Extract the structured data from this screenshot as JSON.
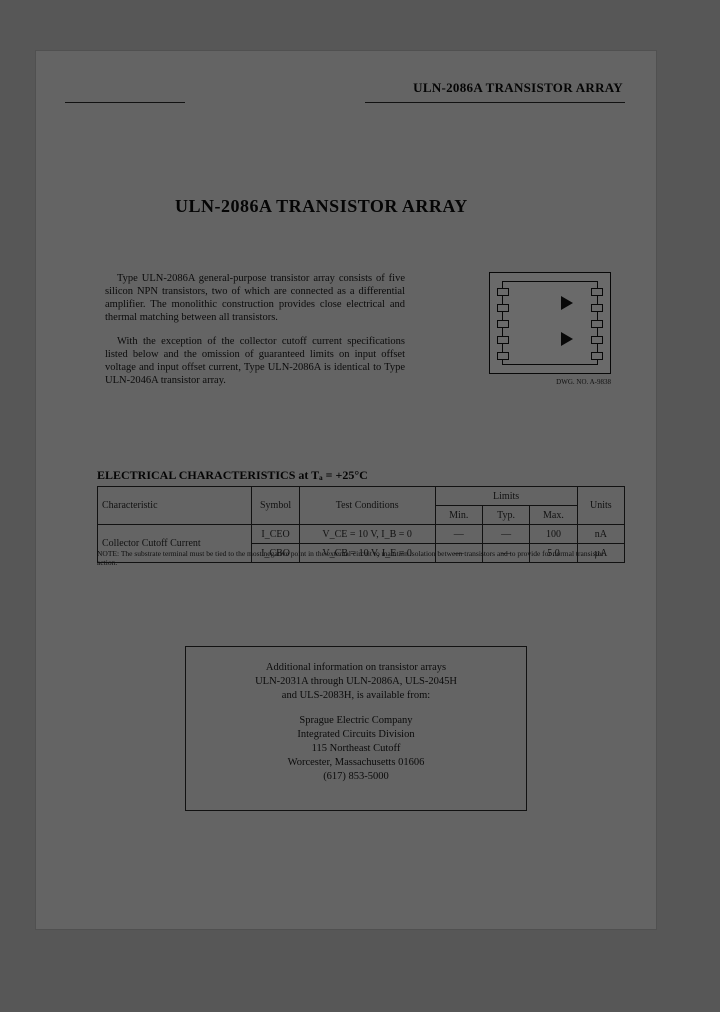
{
  "header": {
    "right_title": "ULN-2086A TRANSISTOR ARRAY"
  },
  "title": "ULN-2086A TRANSISTOR ARRAY",
  "intro": {
    "p1": "Type ULN-2086A general-purpose transistor array consists of five silicon NPN transistors, two of which are connected as a differential amplifier. The monolithic construction provides close electrical and thermal matching between all transistors.",
    "p2": "With the exception of the collector cutoff current specifications listed below and the omission of guaranteed limits on input offset voltage and input offset current, Type ULN-2086A is identical to Type ULN-2046A transistor array."
  },
  "diagram": {
    "caption": "DWG. NO. A-9838"
  },
  "ec_heading": "ELECTRICAL CHARACTERISTICS at Tₐ = +25°C",
  "table": {
    "headers": {
      "characteristic": "Characteristic",
      "symbol": "Symbol",
      "test_conditions": "Test Conditions",
      "limits": "Limits",
      "min": "Min.",
      "typ": "Typ.",
      "max": "Max.",
      "units": "Units"
    },
    "rows": [
      {
        "characteristic": "Collector Cutoff Current",
        "symbol": "I_CEO",
        "test_conditions": "V_CE = 10 V, I_B = 0",
        "min": "—",
        "typ": "—",
        "max": "100",
        "units": "nA"
      },
      {
        "characteristic": "",
        "symbol": "I_CBO",
        "test_conditions": "V_CB = 10 V, I_E = 0",
        "min": "—",
        "typ": "—",
        "max": "5.0",
        "units": "µA"
      }
    ]
  },
  "note": "NOTE: The substrate terminal must be tied to the most negative point in the external circuit to maintain isolation between transistors and to provide for normal transistor action.",
  "info_box": {
    "line1": "Additional information on transistor arrays",
    "line2": "ULN-2031A through ULN-2086A, ULS-2045H",
    "line3": "and ULS-2083H, is available from:",
    "company": "Sprague Electric Company",
    "division": "Integrated Circuits Division",
    "address1": "115 Northeast Cutoff",
    "address2": "Worcester, Massachusetts 01606",
    "phone": "(617) 853-5000"
  }
}
